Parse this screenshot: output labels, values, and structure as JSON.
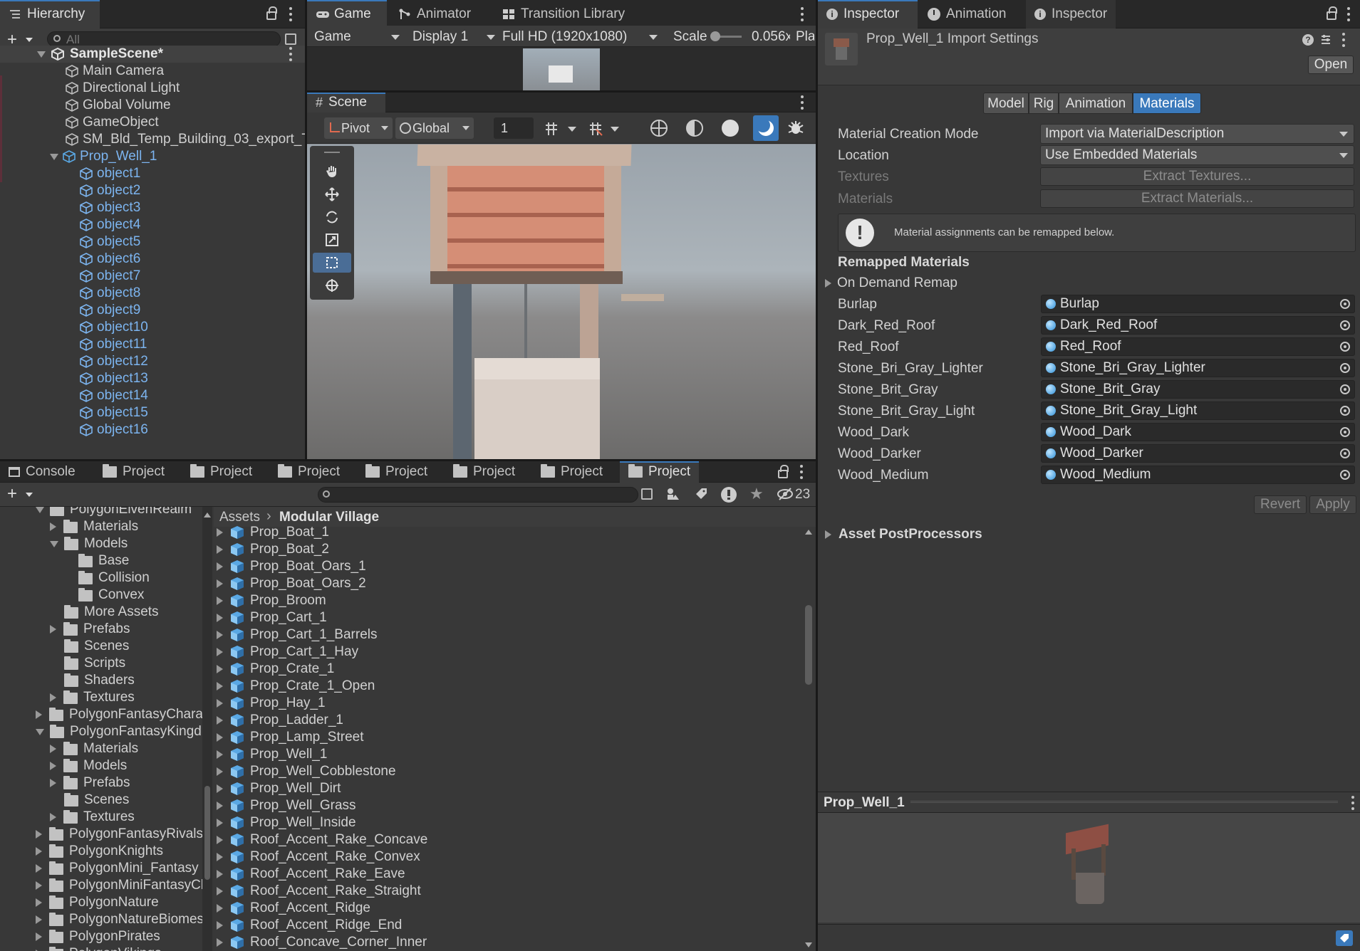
{
  "hierarchy": {
    "tab_label": "Hierarchy",
    "search_placeholder": "All",
    "scene_name": "SampleScene*",
    "items": [
      "Main Camera",
      "Directional Light",
      "Global Volume",
      "GameObject",
      "SM_Bld_Temp_Building_03_export_T"
    ],
    "prefab_root": "Prop_Well_1",
    "children": [
      "object1",
      "object2",
      "object3",
      "object4",
      "object5",
      "object6",
      "object7",
      "object8",
      "object9",
      "object10",
      "object11",
      "object12",
      "object13",
      "object14",
      "object15",
      "object16"
    ]
  },
  "game": {
    "tabs": [
      "Game",
      "Animator",
      "Transition Library"
    ],
    "mode": "Game",
    "display": "Display 1",
    "resolution": "Full HD (1920x1080)",
    "scale_label": "Scale",
    "scale_value": "0.056x",
    "play_truncated": "Pla"
  },
  "scene": {
    "tab_label": "Scene",
    "pivot": "Pivot",
    "space": "Global",
    "grid_value": "1"
  },
  "bottom": {
    "tabs": [
      "Console",
      "Project",
      "Project",
      "Project",
      "Project",
      "Project",
      "Project",
      "Project"
    ],
    "hidden_count": "23",
    "tree": [
      {
        "label": "PolygonElvenRealm",
        "depth": 0,
        "open": true
      },
      {
        "label": "Materials",
        "depth": 1,
        "open": false,
        "arrow": true
      },
      {
        "label": "Models",
        "depth": 1,
        "open": true,
        "arrow": true
      },
      {
        "label": "Base",
        "depth": 2
      },
      {
        "label": "Collision",
        "depth": 2
      },
      {
        "label": "Convex",
        "depth": 2
      },
      {
        "label": "More Assets",
        "depth": 1
      },
      {
        "label": "Prefabs",
        "depth": 1,
        "arrow": true
      },
      {
        "label": "Scenes",
        "depth": 1
      },
      {
        "label": "Scripts",
        "depth": 1
      },
      {
        "label": "Shaders",
        "depth": 1
      },
      {
        "label": "Textures",
        "depth": 1,
        "arrow": true
      },
      {
        "label": "PolygonFantasyChara",
        "depth": 0,
        "arrow": true
      },
      {
        "label": "PolygonFantasyKingd",
        "depth": 0,
        "open": true,
        "arrow": true
      },
      {
        "label": "Materials",
        "depth": 1,
        "arrow": true
      },
      {
        "label": "Models",
        "depth": 1,
        "arrow": true
      },
      {
        "label": "Prefabs",
        "depth": 1,
        "arrow": true
      },
      {
        "label": "Scenes",
        "depth": 1
      },
      {
        "label": "Textures",
        "depth": 1,
        "arrow": true
      },
      {
        "label": "PolygonFantasyRivals",
        "depth": 0,
        "arrow": true
      },
      {
        "label": "PolygonKnights",
        "depth": 0,
        "arrow": true
      },
      {
        "label": "PolygonMini_Fantasy",
        "depth": 0,
        "arrow": true
      },
      {
        "label": "PolygonMiniFantasyCl",
        "depth": 0,
        "arrow": true
      },
      {
        "label": "PolygonNature",
        "depth": 0,
        "arrow": true
      },
      {
        "label": "PolygonNatureBiomes",
        "depth": 0,
        "arrow": true
      },
      {
        "label": "PolygonPirates",
        "depth": 0,
        "arrow": true
      },
      {
        "label": "PolygonVikings",
        "depth": 0,
        "arrow": true
      }
    ],
    "breadcrumb_root": "Assets",
    "breadcrumb_current": "Modular Village",
    "assets": [
      "Prop_Boat_1",
      "Prop_Boat_2",
      "Prop_Boat_Oars_1",
      "Prop_Boat_Oars_2",
      "Prop_Broom",
      "Prop_Cart_1",
      "Prop_Cart_1_Barrels",
      "Prop_Cart_1_Hay",
      "Prop_Crate_1",
      "Prop_Crate_1_Open",
      "Prop_Hay_1",
      "Prop_Ladder_1",
      "Prop_Lamp_Street",
      "Prop_Well_1",
      "Prop_Well_Cobblestone",
      "Prop_Well_Dirt",
      "Prop_Well_Grass",
      "Prop_Well_Inside",
      "Roof_Accent_Rake_Concave",
      "Roof_Accent_Rake_Convex",
      "Roof_Accent_Rake_Eave",
      "Roof_Accent_Rake_Straight",
      "Roof_Accent_Ridge",
      "Roof_Accent_Ridge_End",
      "Roof_Concave_Corner_Inner"
    ]
  },
  "inspector": {
    "tabs": [
      "Inspector",
      "Animation",
      "Inspector"
    ],
    "title": "Prop_Well_1 Import Settings",
    "open_button": "Open",
    "subtabs": [
      "Model",
      "Rig",
      "Animation",
      "Materials"
    ],
    "active_subtab": "Materials",
    "material_creation_mode_label": "Material Creation Mode",
    "material_creation_mode_value": "Import via MaterialDescription",
    "location_label": "Location",
    "location_value": "Use Embedded Materials",
    "textures_label": "Textures",
    "extract_textures": "Extract Textures...",
    "materials_label": "Materials",
    "extract_materials": "Extract Materials...",
    "info_message": "Material assignments can be remapped below.",
    "remapped_header": "Remapped Materials",
    "on_demand_remap": "On Demand Remap",
    "remaps": [
      {
        "name": "Burlap",
        "value": "Burlap"
      },
      {
        "name": "Dark_Red_Roof",
        "value": "Dark_Red_Roof"
      },
      {
        "name": "Red_Roof",
        "value": "Red_Roof"
      },
      {
        "name": "Stone_Bri_Gray_Lighter",
        "value": "Stone_Bri_Gray_Lighter"
      },
      {
        "name": "Stone_Brit_Gray",
        "value": "Stone_Brit_Gray"
      },
      {
        "name": "Stone_Brit_Gray_Light",
        "value": "Stone_Brit_Gray_Light"
      },
      {
        "name": "Wood_Dark",
        "value": "Wood_Dark"
      },
      {
        "name": "Wood_Darker",
        "value": "Wood_Darker"
      },
      {
        "name": "Wood_Medium",
        "value": "Wood_Medium"
      }
    ],
    "revert": "Revert",
    "apply": "Apply",
    "asset_postprocessors": "Asset PostProcessors",
    "preview_title": "Prop_Well_1"
  },
  "colors": {
    "accent": "#3a79bb",
    "selection_text": "#7cb4ef",
    "panel": "#383838",
    "tabbar": "#282828"
  }
}
